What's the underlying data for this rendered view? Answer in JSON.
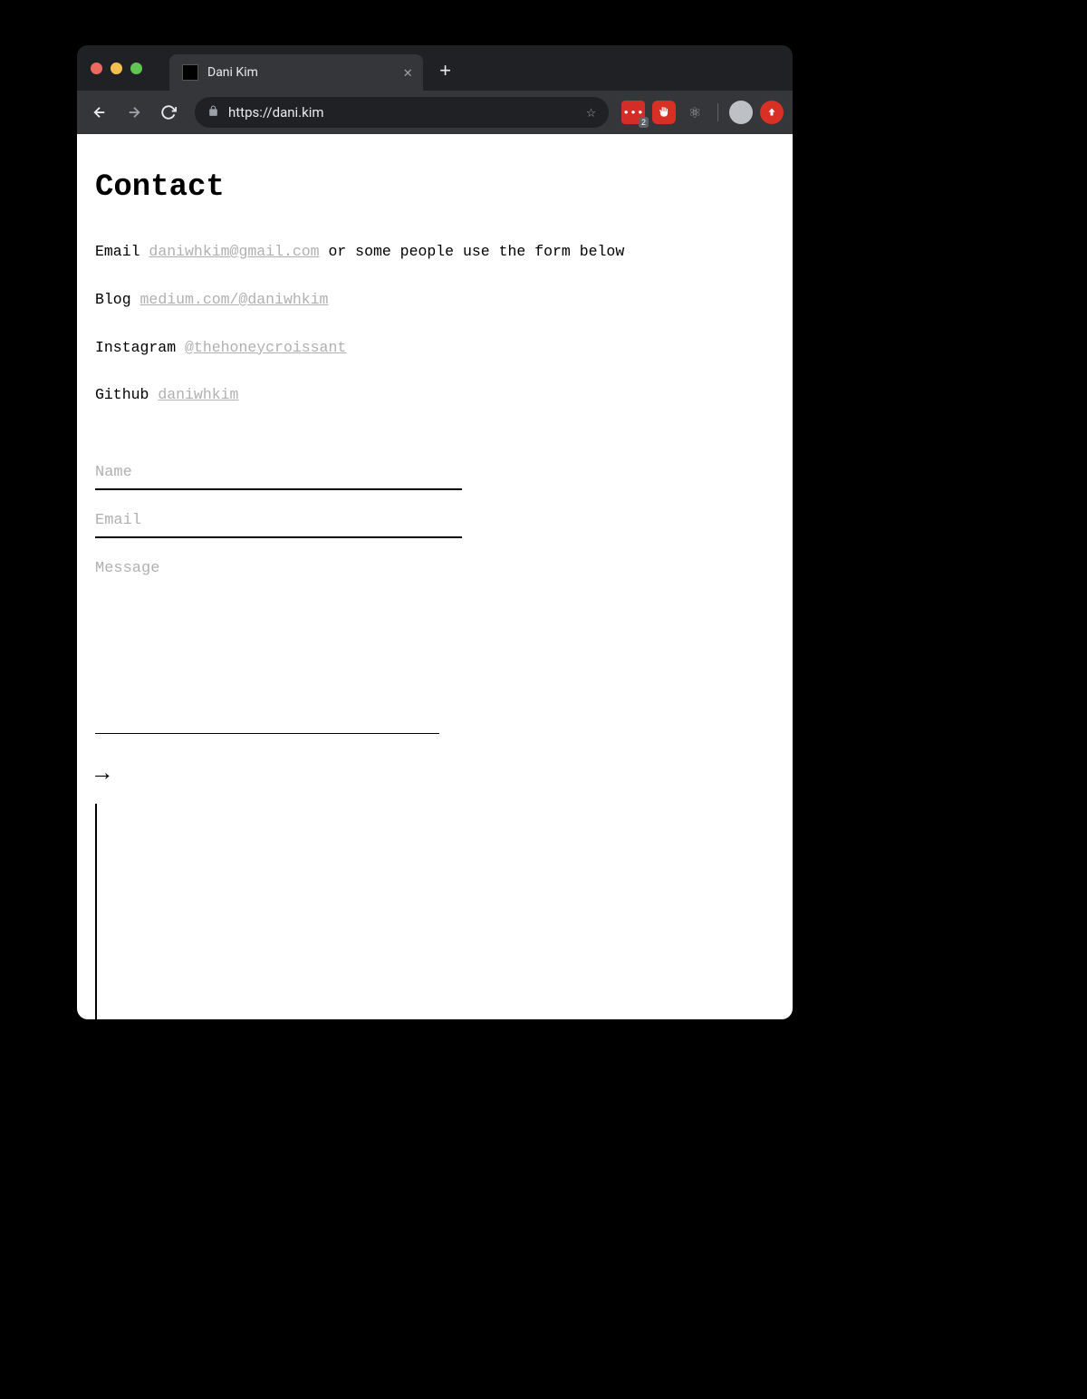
{
  "browser": {
    "tab_title": "Dani Kim",
    "url": "https://dani.kim",
    "extension_badge": "2"
  },
  "page": {
    "heading": "Contact",
    "contacts": {
      "email": {
        "label": "Email",
        "link": "daniwhkim@gmail.com",
        "suffix": " or some people use the form below"
      },
      "blog": {
        "label": "Blog",
        "link": "medium.com/@daniwhkim"
      },
      "instagram": {
        "label": "Instagram",
        "link": "@thehoneycroissant"
      },
      "github": {
        "label": "Github",
        "link": "daniwhkim"
      }
    },
    "form": {
      "name_placeholder": "Name",
      "email_placeholder": "Email",
      "message_placeholder": "Message",
      "submit": "→"
    }
  }
}
